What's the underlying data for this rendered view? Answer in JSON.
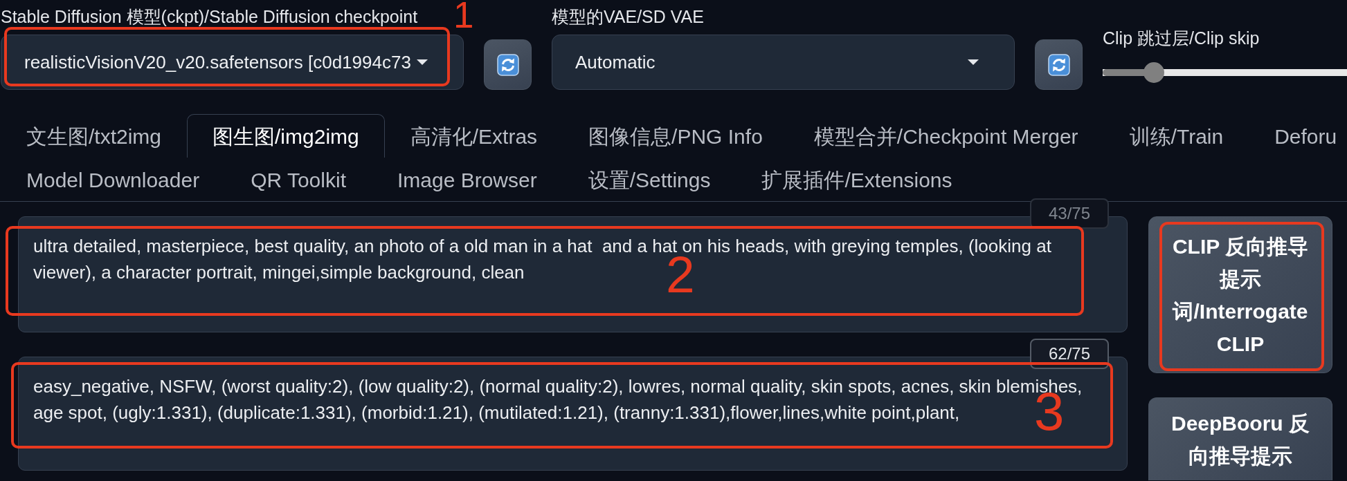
{
  "checkpoint": {
    "label": "Stable Diffusion 模型(ckpt)/Stable Diffusion checkpoint",
    "value": "realisticVisionV20_v20.safetensors [c0d1994c73",
    "highlighted": true,
    "highlight_number": "1"
  },
  "vae": {
    "label": "模型的VAE/SD VAE",
    "value": "Automatic"
  },
  "clip_skip": {
    "label": "Clip 跳过层/Clip skip",
    "level": 0.21
  },
  "tab_rows": [
    {
      "tabs": [
        {
          "label": "文生图/txt2img",
          "selected": false
        },
        {
          "label": "图生图/img2img",
          "selected": true
        },
        {
          "label": "高清化/Extras",
          "selected": false
        },
        {
          "label": "图像信息/PNG Info",
          "selected": false
        },
        {
          "label": "模型合并/Checkpoint Merger",
          "selected": false
        },
        {
          "label": "训练/Train",
          "selected": false
        },
        {
          "label": "Deforu",
          "selected": false
        }
      ]
    },
    {
      "tabs": [
        {
          "label": "Model Downloader",
          "selected": false
        },
        {
          "label": "QR Toolkit",
          "selected": false
        },
        {
          "label": "Image Browser",
          "selected": false
        },
        {
          "label": "设置/Settings",
          "selected": false
        },
        {
          "label": "扩展插件/Extensions",
          "selected": false
        }
      ]
    }
  ],
  "prompt": {
    "value": "ultra detailed, masterpiece, best quality, an photo of a old man in a hat  and a hat on his heads, with greying temples, (looking at viewer), a character portrait, mingei,simple background, clean",
    "token_count": "43/75",
    "counter_dimmed": true,
    "highlighted": true,
    "highlight_number": "2"
  },
  "negative_prompt": {
    "value": "easy_negative, NSFW, (worst quality:2), (low quality:2), (normal quality:2), lowres, normal quality, skin spots, acnes, skin blemishes, age spot, (ugly:1.331), (duplicate:1.331), (morbid:1.21), (mutilated:1.21), (tranny:1.331),flower,lines,white point,plant,",
    "token_count": "62/75",
    "counter_dimmed": false,
    "highlighted": true,
    "highlight_number": "3"
  },
  "side_buttons": [
    {
      "label": "CLIP 反向推导提示词/Interrogate CLIP",
      "highlighted": true
    },
    {
      "label": "DeepBooru 反向推导提示",
      "highlighted": false
    }
  ]
}
